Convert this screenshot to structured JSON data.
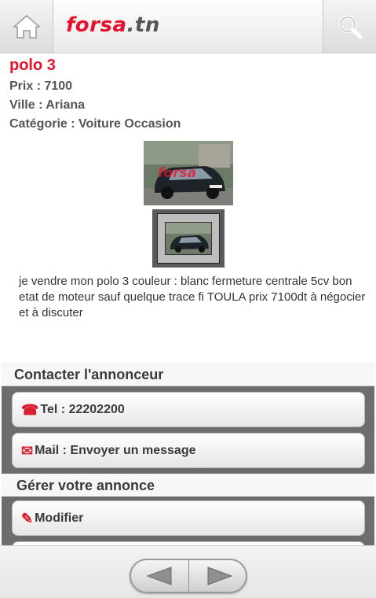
{
  "header": {
    "logo_brand": "forsa",
    "logo_tld": ".tn",
    "home_icon": "home-icon",
    "search_icon": "search-icon"
  },
  "listing": {
    "title": "polo 3",
    "price": "Prix : 7100",
    "city": "Ville : Ariana",
    "category": "Catégorie : Voiture Occasion",
    "photo_watermark": "forsa",
    "description": "je vendre mon polo 3 couleur : blanc fermeture centrale 5cv bon etat de moteur sauf quelque trace fi TOULA prix 7100dt à négocier et à discuter"
  },
  "contact": {
    "title": "Contacter l'annonceur",
    "tel_label": "Tel : 22202200",
    "mail_label": "Mail : Envoyer un message",
    "phone_icon": "phone-icon",
    "mail_icon": "mail-icon"
  },
  "manage": {
    "title": "Gérer votre annonce",
    "edit_label": "Modifier",
    "edit_icon": "pencil-icon"
  },
  "nav": {
    "prev_icon": "arrow-left-icon",
    "next_icon": "arrow-right-icon"
  },
  "colors": {
    "accent": "#e8112d",
    "panel": "#6d6d6d"
  }
}
